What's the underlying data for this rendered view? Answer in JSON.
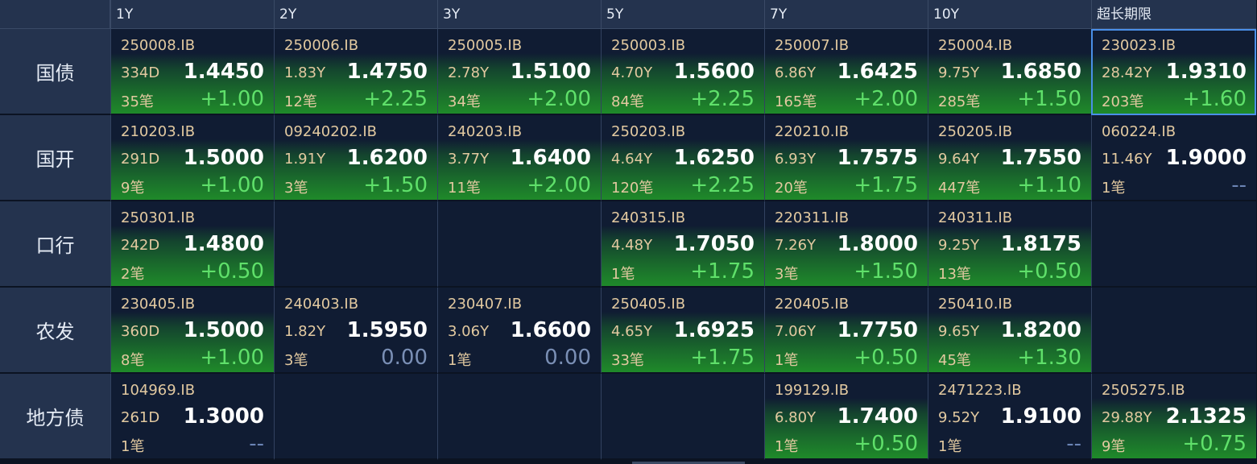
{
  "columns": [
    "1Y",
    "2Y",
    "3Y",
    "5Y",
    "7Y",
    "10Y",
    "超长期限"
  ],
  "rows": [
    {
      "label": "国债",
      "cells": [
        {
          "code": "250008.IB",
          "term": "334D",
          "yield": "1.4450",
          "count": "35笔",
          "change": "+1.00",
          "style": "green",
          "trend": "up"
        },
        {
          "code": "250006.IB",
          "term": "1.83Y",
          "yield": "1.4750",
          "count": "12笔",
          "change": "+2.25",
          "style": "green",
          "trend": "up"
        },
        {
          "code": "250005.IB",
          "term": "2.78Y",
          "yield": "1.5100",
          "count": "34笔",
          "change": "+2.00",
          "style": "green",
          "trend": "up"
        },
        {
          "code": "250003.IB",
          "term": "4.70Y",
          "yield": "1.5600",
          "count": "84笔",
          "change": "+2.25",
          "style": "green",
          "trend": "up"
        },
        {
          "code": "250007.IB",
          "term": "6.86Y",
          "yield": "1.6425",
          "count": "165笔",
          "change": "+2.00",
          "style": "green",
          "trend": "up"
        },
        {
          "code": "250004.IB",
          "term": "9.75Y",
          "yield": "1.6850",
          "count": "285笔",
          "change": "+1.50",
          "style": "green",
          "trend": "up"
        },
        {
          "code": "230023.IB",
          "term": "28.42Y",
          "yield": "1.9310",
          "count": "203笔",
          "change": "+1.60",
          "style": "green",
          "trend": "up",
          "selected": true
        }
      ]
    },
    {
      "label": "国开",
      "cells": [
        {
          "code": "210203.IB",
          "term": "291D",
          "yield": "1.5000",
          "count": "9笔",
          "change": "+1.00",
          "style": "green",
          "trend": "up"
        },
        {
          "code": "09240202.IB",
          "term": "1.91Y",
          "yield": "1.6200",
          "count": "3笔",
          "change": "+1.50",
          "style": "green",
          "trend": "up"
        },
        {
          "code": "240203.IB",
          "term": "3.77Y",
          "yield": "1.6400",
          "count": "11笔",
          "change": "+2.00",
          "style": "green",
          "trend": "up"
        },
        {
          "code": "250203.IB",
          "term": "4.64Y",
          "yield": "1.6250",
          "count": "120笔",
          "change": "+2.25",
          "style": "green",
          "trend": "up"
        },
        {
          "code": "220210.IB",
          "term": "6.93Y",
          "yield": "1.7575",
          "count": "20笔",
          "change": "+1.75",
          "style": "green",
          "trend": "up"
        },
        {
          "code": "250205.IB",
          "term": "9.64Y",
          "yield": "1.7550",
          "count": "447笔",
          "change": "+1.10",
          "style": "green",
          "trend": "up"
        },
        {
          "code": "060224.IB",
          "term": "11.46Y",
          "yield": "1.9000",
          "count": "1笔",
          "change": "--",
          "style": "plain",
          "trend": "none"
        }
      ]
    },
    {
      "label": "口行",
      "cells": [
        {
          "code": "250301.IB",
          "term": "242D",
          "yield": "1.4800",
          "count": "2笔",
          "change": "+0.50",
          "style": "green",
          "trend": "up"
        },
        null,
        null,
        {
          "code": "240315.IB",
          "term": "4.48Y",
          "yield": "1.7050",
          "count": "1笔",
          "change": "+1.75",
          "style": "green",
          "trend": "up"
        },
        {
          "code": "220311.IB",
          "term": "7.26Y",
          "yield": "1.8000",
          "count": "3笔",
          "change": "+1.50",
          "style": "green",
          "trend": "up"
        },
        {
          "code": "240311.IB",
          "term": "9.25Y",
          "yield": "1.8175",
          "count": "13笔",
          "change": "+0.50",
          "style": "green",
          "trend": "up"
        },
        null
      ]
    },
    {
      "label": "农发",
      "cells": [
        {
          "code": "230405.IB",
          "term": "360D",
          "yield": "1.5000",
          "count": "8笔",
          "change": "+1.00",
          "style": "green",
          "trend": "up"
        },
        {
          "code": "240403.IB",
          "term": "1.82Y",
          "yield": "1.5950",
          "count": "3笔",
          "change": "0.00",
          "style": "plain",
          "trend": "flat"
        },
        {
          "code": "230407.IB",
          "term": "3.06Y",
          "yield": "1.6600",
          "count": "1笔",
          "change": "0.00",
          "style": "plain",
          "trend": "flat"
        },
        {
          "code": "250405.IB",
          "term": "4.65Y",
          "yield": "1.6925",
          "count": "33笔",
          "change": "+1.75",
          "style": "green",
          "trend": "up"
        },
        {
          "code": "220405.IB",
          "term": "7.06Y",
          "yield": "1.7750",
          "count": "1笔",
          "change": "+0.50",
          "style": "green",
          "trend": "up"
        },
        {
          "code": "250410.IB",
          "term": "9.65Y",
          "yield": "1.8200",
          "count": "45笔",
          "change": "+1.30",
          "style": "green",
          "trend": "up"
        },
        null
      ]
    },
    {
      "label": "地方债",
      "cells": [
        {
          "code": "104969.IB",
          "term": "261D",
          "yield": "1.3000",
          "count": "1笔",
          "change": "--",
          "style": "plain",
          "trend": "none"
        },
        null,
        null,
        null,
        {
          "code": "199129.IB",
          "term": "6.80Y",
          "yield": "1.7400",
          "count": "1笔",
          "change": "+0.50",
          "style": "green",
          "trend": "up"
        },
        {
          "code": "2471223.IB",
          "term": "9.52Y",
          "yield": "1.9100",
          "count": "1笔",
          "change": "--",
          "style": "plain",
          "trend": "none"
        },
        {
          "code": "2505275.IB",
          "term": "29.88Y",
          "yield": "2.1325",
          "count": "9笔",
          "change": "+0.75",
          "style": "green",
          "trend": "up"
        }
      ]
    }
  ],
  "colors": {
    "background": "#0b1322",
    "header": "#24334e",
    "cell": "#101c33",
    "up": "#5fe06a",
    "flat": "#7a8fb5",
    "text_meta": "#e2c9a0",
    "selected_border": "#4a8fe8"
  }
}
